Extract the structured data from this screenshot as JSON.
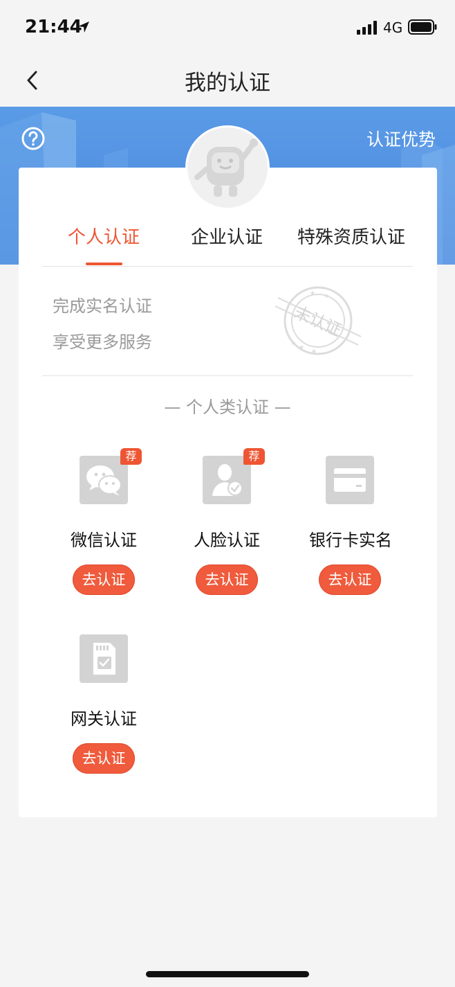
{
  "status_bar": {
    "time": "21:44",
    "network": "4G"
  },
  "nav": {
    "title": "我的认证",
    "back_icon": "chevron-left-icon"
  },
  "hero": {
    "help_icon": "question-circle-icon",
    "advantage_link": "认证优势",
    "bg_color": "#4a86dc"
  },
  "tabs": [
    {
      "label": "个人认证",
      "active": true
    },
    {
      "label": "企业认证",
      "active": false
    },
    {
      "label": "特殊资质认证",
      "active": false
    }
  ],
  "promo": {
    "line1": "完成实名认证",
    "line2": "享受更多服务",
    "stamp_text": "未认证"
  },
  "section": {
    "title": "— 个人类认证 —"
  },
  "methods": [
    {
      "label": "微信认证",
      "badge": "荐",
      "button": "去认证",
      "icon": "wechat-icon"
    },
    {
      "label": "人脸认证",
      "badge": "荐",
      "button": "去认证",
      "icon": "face-verify-icon"
    },
    {
      "label": "银行卡实名",
      "badge": "",
      "button": "去认证",
      "icon": "bank-card-icon"
    },
    {
      "label": "网关认证",
      "badge": "",
      "button": "去认证",
      "icon": "sim-card-icon"
    }
  ],
  "colors": {
    "accent": "#ee5533",
    "icon_bg": "#d3d3d3"
  }
}
